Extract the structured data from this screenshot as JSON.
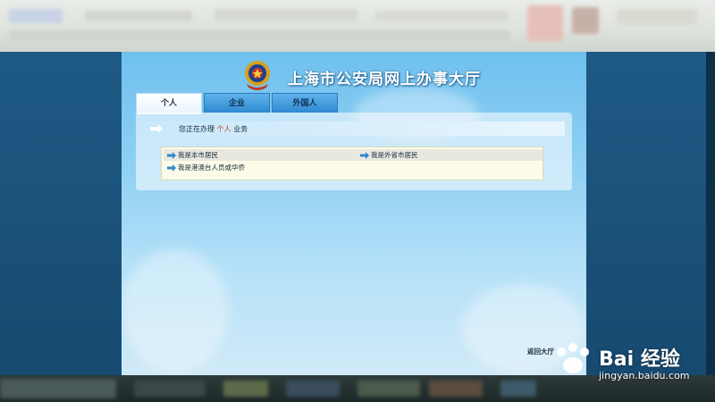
{
  "header": {
    "title": "上海市公安局网上办事大厅"
  },
  "tabs": [
    {
      "label": "个人",
      "active": true
    },
    {
      "label": "企业",
      "active": false
    },
    {
      "label": "外国人",
      "active": false
    }
  ],
  "panel": {
    "prefix": "您正在办理",
    "highlight": "个人",
    "suffix": "业务"
  },
  "options": [
    {
      "label": "我是本市居民"
    },
    {
      "label": "我是外省市居民"
    },
    {
      "label": "我是港澳台人员或华侨"
    }
  ],
  "return_label": "返回大厅",
  "watermark": {
    "brand": "Bai 经验",
    "url": "jingyan.baidu.com"
  },
  "colors": {
    "accent": "#2f89cf",
    "highlight": "#c0392b",
    "background": "#1c4f75"
  }
}
